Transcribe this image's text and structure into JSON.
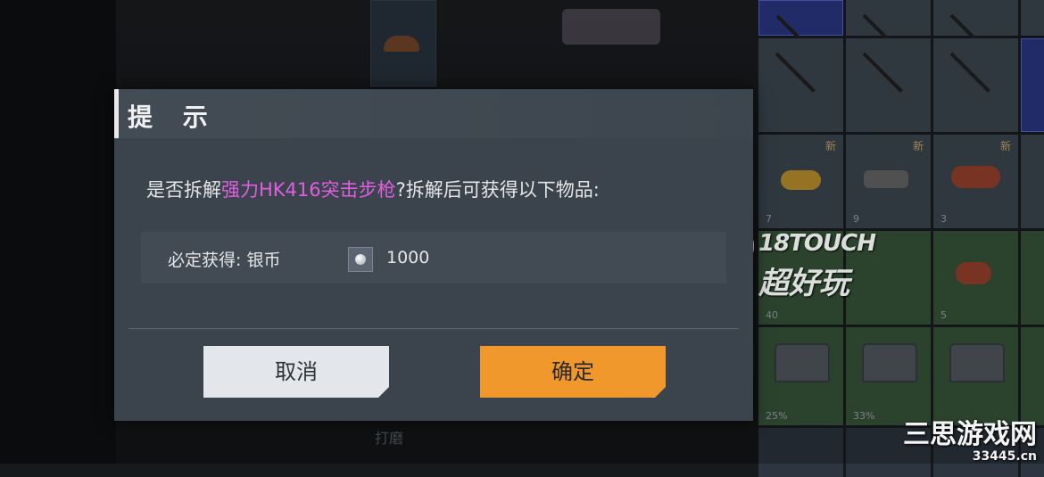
{
  "dialog": {
    "title": "提 示",
    "message_prefix": "是否拆解",
    "item_name": "强力HK416突击步枪",
    "message_suffix": "?拆解后可获得以下物品:",
    "reward_label": "必定获得: 银币",
    "reward_icon": "silver-coin-icon",
    "reward_amount": "1000",
    "cancel_label": "取消",
    "confirm_label": "确定"
  },
  "background": {
    "inventory_new_badges": [
      "新",
      "新",
      "新"
    ],
    "inventory_counts": [
      "7",
      "9",
      "3",
      "40",
      "5",
      "25%",
      "33%"
    ],
    "bottom_text": "打磨"
  },
  "watermarks": {
    "brand_en": "18TOUCH",
    "brand_cn": "超好玩",
    "site_name": "三思游戏网",
    "site_url": "33445.cn"
  },
  "colors": {
    "highlight": "#e05fe0",
    "confirm_button": "#f0982c",
    "cancel_button": "#e3e6ea",
    "dialog_bg": "#3b434c"
  }
}
